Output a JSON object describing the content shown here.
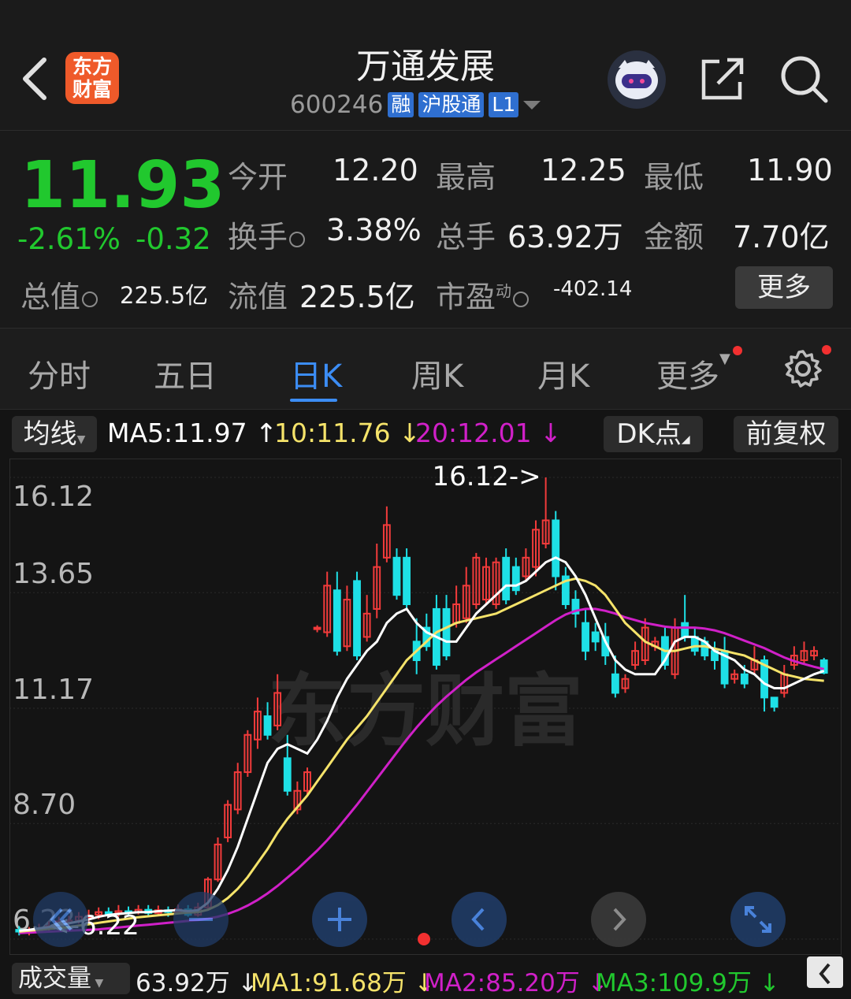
{
  "header": {
    "title": "万通发展",
    "code": "600246",
    "tags": [
      "融",
      "沪股通",
      "L1"
    ],
    "logo_text": [
      "东方",
      "财富"
    ]
  },
  "quote": {
    "price": "11.93",
    "change_pct": "-2.61%",
    "change": "-0.32",
    "open_label": "今开",
    "open": "12.20",
    "high_label": "最高",
    "high": "12.25",
    "low_label": "最低",
    "low": "11.90",
    "turnover_label": "换手",
    "turnover": "3.38%",
    "volume_label": "总手",
    "volume": "63.92万",
    "amount_label": "金额",
    "amount": "7.70亿",
    "mktcap_label": "总值",
    "mktcap": "225.5亿",
    "float_label": "流值",
    "float": "225.5亿",
    "pe_label": "市盈",
    "pe_sup": "动",
    "pe": "-402.14",
    "more": "更多"
  },
  "tabs": [
    "分时",
    "五日",
    "日K",
    "周K",
    "月K",
    "更多"
  ],
  "ma_row": {
    "ma_select": "均线",
    "ma5": "MA5:11.97",
    "ma10": "10:11.76",
    "ma20": "20:12.01",
    "dk": "DK点",
    "adjust": "前复权"
  },
  "colors": {
    "up": "#f23b3b",
    "down": "#1ee0e6",
    "ma5": "#ffffff",
    "ma10": "#f5e36a",
    "ma20": "#d020c8",
    "accent": "#3c8df5",
    "price_down": "#21c82e"
  },
  "chart_data": {
    "type": "candlestick",
    "y_ticks": [
      "16.12",
      "13.65",
      "11.17",
      "8.70",
      "6.22"
    ],
    "ylim": [
      6.22,
      16.12
    ],
    "max_label": "16.12->",
    "min_label": "<-6.22",
    "watermark": "东方财富",
    "candles": [
      [
        6.42,
        6.38,
        6.3,
        6.5
      ],
      [
        6.36,
        6.4,
        6.3,
        6.48
      ],
      [
        6.4,
        6.44,
        6.35,
        6.55
      ],
      [
        6.45,
        6.5,
        6.4,
        6.6
      ],
      [
        6.52,
        6.6,
        6.45,
        6.7
      ],
      [
        6.58,
        6.62,
        6.5,
        6.72
      ],
      [
        6.62,
        6.7,
        6.55,
        6.8
      ],
      [
        6.7,
        6.72,
        6.6,
        6.85
      ],
      [
        6.74,
        6.8,
        6.65,
        6.9
      ],
      [
        6.8,
        6.78,
        6.7,
        6.9
      ],
      [
        6.78,
        6.82,
        6.7,
        6.95
      ],
      [
        6.82,
        6.8,
        6.72,
        6.92
      ],
      [
        6.8,
        6.85,
        6.75,
        6.95
      ],
      [
        6.85,
        6.78,
        6.7,
        6.95
      ],
      [
        6.78,
        6.84,
        6.72,
        6.94
      ],
      [
        6.84,
        6.8,
        6.7,
        6.92
      ],
      [
        6.8,
        6.86,
        6.75,
        6.96
      ],
      [
        6.86,
        6.74,
        6.7,
        6.95
      ],
      [
        6.74,
        6.9,
        6.7,
        7.0
      ],
      [
        6.9,
        7.5,
        6.85,
        7.55
      ],
      [
        7.5,
        8.25,
        7.45,
        8.4
      ],
      [
        8.4,
        9.1,
        8.3,
        9.2
      ],
      [
        9.0,
        9.8,
        8.9,
        10.0
      ],
      [
        9.8,
        10.6,
        9.7,
        10.7
      ],
      [
        10.5,
        11.1,
        10.3,
        11.4
      ],
      [
        11.0,
        10.6,
        10.5,
        11.3
      ],
      [
        10.8,
        11.5,
        10.7,
        11.9
      ],
      [
        10.1,
        9.4,
        9.3,
        10.6
      ],
      [
        9.0,
        9.4,
        8.9,
        9.6
      ],
      [
        9.4,
        9.8,
        9.3,
        9.9
      ],
      [
        12.9,
        12.9,
        12.8,
        12.95
      ],
      [
        12.8,
        13.8,
        12.7,
        14.1
      ],
      [
        13.7,
        12.4,
        12.3,
        14.1
      ],
      [
        12.5,
        13.5,
        12.4,
        13.8
      ],
      [
        13.9,
        12.3,
        12.2,
        14.1
      ],
      [
        12.7,
        13.2,
        12.6,
        13.6
      ],
      [
        13.3,
        14.2,
        13.1,
        14.7
      ],
      [
        14.4,
        15.1,
        14.3,
        15.5
      ],
      [
        14.4,
        13.6,
        13.5,
        14.6
      ],
      [
        14.4,
        13.4,
        13.3,
        14.6
      ],
      [
        12.6,
        12.2,
        11.9,
        13.1
      ],
      [
        12.9,
        12.5,
        12.4,
        13.2
      ],
      [
        13.3,
        12.1,
        12.0,
        13.6
      ],
      [
        13.3,
        12.3,
        12.2,
        13.6
      ],
      [
        13.0,
        13.4,
        12.9,
        13.8
      ],
      [
        13.1,
        13.8,
        13.0,
        14.2
      ],
      [
        13.4,
        14.4,
        13.3,
        14.5
      ],
      [
        13.5,
        14.2,
        13.4,
        14.4
      ],
      [
        13.4,
        14.3,
        13.3,
        14.4
      ],
      [
        14.4,
        13.5,
        13.4,
        14.6
      ],
      [
        14.2,
        13.7,
        13.6,
        14.4
      ],
      [
        14.0,
        14.4,
        13.9,
        14.6
      ],
      [
        14.2,
        15.0,
        14.0,
        15.2
      ],
      [
        14.7,
        15.2,
        14.6,
        16.12
      ],
      [
        15.2,
        14.0,
        13.7,
        15.4
      ],
      [
        14.0,
        13.4,
        13.3,
        14.2
      ],
      [
        13.5,
        13.2,
        12.9,
        13.7
      ],
      [
        13.0,
        12.4,
        12.2,
        13.3
      ],
      [
        12.8,
        12.6,
        12.4,
        13.0
      ],
      [
        12.7,
        12.3,
        12.1,
        13.0
      ],
      [
        11.9,
        11.5,
        11.4,
        12.3
      ],
      [
        11.6,
        11.8,
        11.5,
        11.9
      ],
      [
        12.1,
        12.4,
        12.0,
        12.6
      ],
      [
        12.2,
        12.9,
        12.1,
        13.1
      ],
      [
        12.5,
        12.6,
        12.4,
        12.7
      ],
      [
        12.7,
        12.1,
        12.0,
        12.9
      ],
      [
        11.9,
        12.9,
        11.8,
        13.1
      ],
      [
        13.0,
        12.7,
        12.6,
        13.6
      ],
      [
        12.7,
        12.4,
        12.3,
        12.9
      ],
      [
        12.6,
        12.3,
        12.2,
        12.7
      ],
      [
        12.4,
        12.2,
        12.0,
        12.6
      ],
      [
        12.4,
        11.7,
        11.6,
        12.7
      ],
      [
        11.8,
        11.9,
        11.7,
        12.0
      ],
      [
        11.9,
        11.7,
        11.6,
        12.1
      ],
      [
        12.0,
        12.2,
        11.9,
        12.5
      ],
      [
        12.2,
        11.4,
        11.1,
        12.3
      ],
      [
        11.4,
        11.2,
        11.1,
        11.4
      ],
      [
        11.5,
        11.9,
        11.4,
        12.1
      ],
      [
        12.1,
        12.3,
        12.0,
        12.5
      ],
      [
        12.2,
        12.4,
        12.1,
        12.6
      ],
      [
        12.3,
        12.4,
        12.2,
        12.5
      ],
      [
        12.2,
        11.93,
        11.9,
        12.25
      ]
    ],
    "ma5": [
      6.4,
      6.42,
      6.45,
      6.48,
      6.52,
      6.56,
      6.6,
      6.64,
      6.7,
      6.74,
      6.76,
      6.78,
      6.8,
      6.8,
      6.82,
      6.83,
      6.84,
      6.82,
      6.84,
      7.0,
      7.3,
      7.7,
      8.2,
      8.8,
      9.4,
      10.0,
      10.3,
      10.4,
      10.3,
      10.2,
      10.5,
      10.9,
      11.4,
      11.8,
      12.1,
      12.4,
      12.6,
      13.0,
      13.2,
      13.3,
      13.0,
      12.8,
      12.7,
      12.6,
      12.6,
      12.9,
      13.2,
      13.4,
      13.6,
      13.8,
      13.8,
      13.9,
      14.1,
      14.3,
      14.4,
      14.3,
      14.0,
      13.6,
      13.1,
      12.6,
      12.2,
      12.0,
      11.9,
      11.9,
      11.9,
      12.2,
      12.6,
      12.7,
      12.7,
      12.6,
      12.4,
      12.3,
      12.2,
      12.0,
      11.9,
      11.7,
      11.6,
      11.6,
      11.7,
      11.8,
      11.9,
      11.97
    ],
    "ma10": [
      6.38,
      6.4,
      6.42,
      6.44,
      6.46,
      6.48,
      6.51,
      6.54,
      6.57,
      6.6,
      6.63,
      6.66,
      6.69,
      6.71,
      6.73,
      6.75,
      6.77,
      6.79,
      6.8,
      6.85,
      6.95,
      7.1,
      7.3,
      7.55,
      7.85,
      8.15,
      8.5,
      8.8,
      9.05,
      9.3,
      9.6,
      9.9,
      10.2,
      10.5,
      10.75,
      11.0,
      11.3,
      11.6,
      11.9,
      12.2,
      12.4,
      12.6,
      12.8,
      12.9,
      13.0,
      13.05,
      13.1,
      13.15,
      13.2,
      13.3,
      13.4,
      13.5,
      13.6,
      13.7,
      13.8,
      13.9,
      13.95,
      13.9,
      13.8,
      13.6,
      13.3,
      13.0,
      12.8,
      12.6,
      12.5,
      12.4,
      12.4,
      12.45,
      12.5,
      12.5,
      12.45,
      12.4,
      12.35,
      12.3,
      12.2,
      12.1,
      12.0,
      11.9,
      11.85,
      11.8,
      11.78,
      11.76
    ],
    "ma20": [
      6.35,
      6.36,
      6.37,
      6.38,
      6.39,
      6.4,
      6.41,
      6.42,
      6.43,
      6.45,
      6.47,
      6.49,
      6.51,
      6.53,
      6.55,
      6.57,
      6.59,
      6.61,
      6.63,
      6.66,
      6.7,
      6.76,
      6.84,
      6.94,
      7.06,
      7.2,
      7.36,
      7.54,
      7.72,
      7.92,
      8.12,
      8.34,
      8.58,
      8.84,
      9.1,
      9.38,
      9.66,
      9.94,
      10.22,
      10.5,
      10.76,
      11.0,
      11.22,
      11.42,
      11.6,
      11.78,
      11.94,
      12.08,
      12.22,
      12.36,
      12.5,
      12.64,
      12.78,
      12.92,
      13.06,
      13.18,
      13.26,
      13.3,
      13.3,
      13.26,
      13.2,
      13.12,
      13.06,
      13.0,
      12.96,
      12.92,
      12.9,
      12.9,
      12.9,
      12.88,
      12.84,
      12.78,
      12.7,
      12.62,
      12.54,
      12.46,
      12.36,
      12.26,
      12.18,
      12.12,
      12.06,
      12.01
    ]
  },
  "volume": {
    "label": "成交量",
    "vol": "63.92万",
    "ma1": "MA1:91.68万",
    "ma2": "MA2:85.20万",
    "ma3": "MA3:109.9万"
  }
}
